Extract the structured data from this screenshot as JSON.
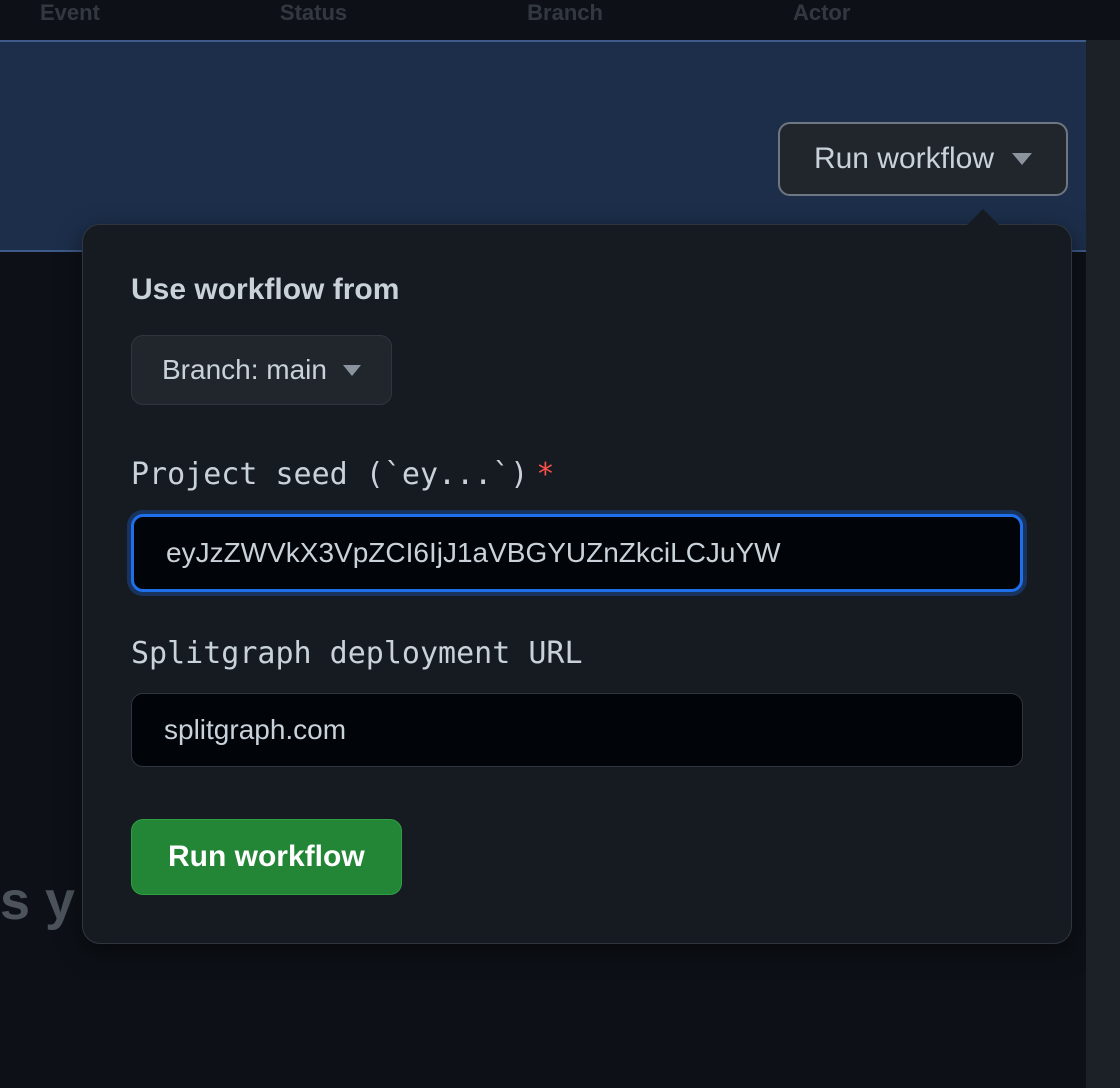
{
  "header": {
    "columns": [
      "Event",
      "Status",
      "Branch",
      "Actor"
    ]
  },
  "trigger": {
    "label": "Run workflow"
  },
  "popover": {
    "useWorkflowLabel": "Use workflow from",
    "branchSelector": {
      "prefix": "Branch: ",
      "value": "main"
    },
    "fields": [
      {
        "label": "Project seed (`ey...`)",
        "required": true,
        "value": "eyJzZWVkX3VpZCI6IjJ1aVBGYUZnZkciLCJuYW"
      },
      {
        "label": "Splitgraph deployment URL",
        "required": false,
        "value": "splitgraph.com"
      }
    ],
    "submitLabel": "Run workflow"
  },
  "backgroundText": "s y"
}
